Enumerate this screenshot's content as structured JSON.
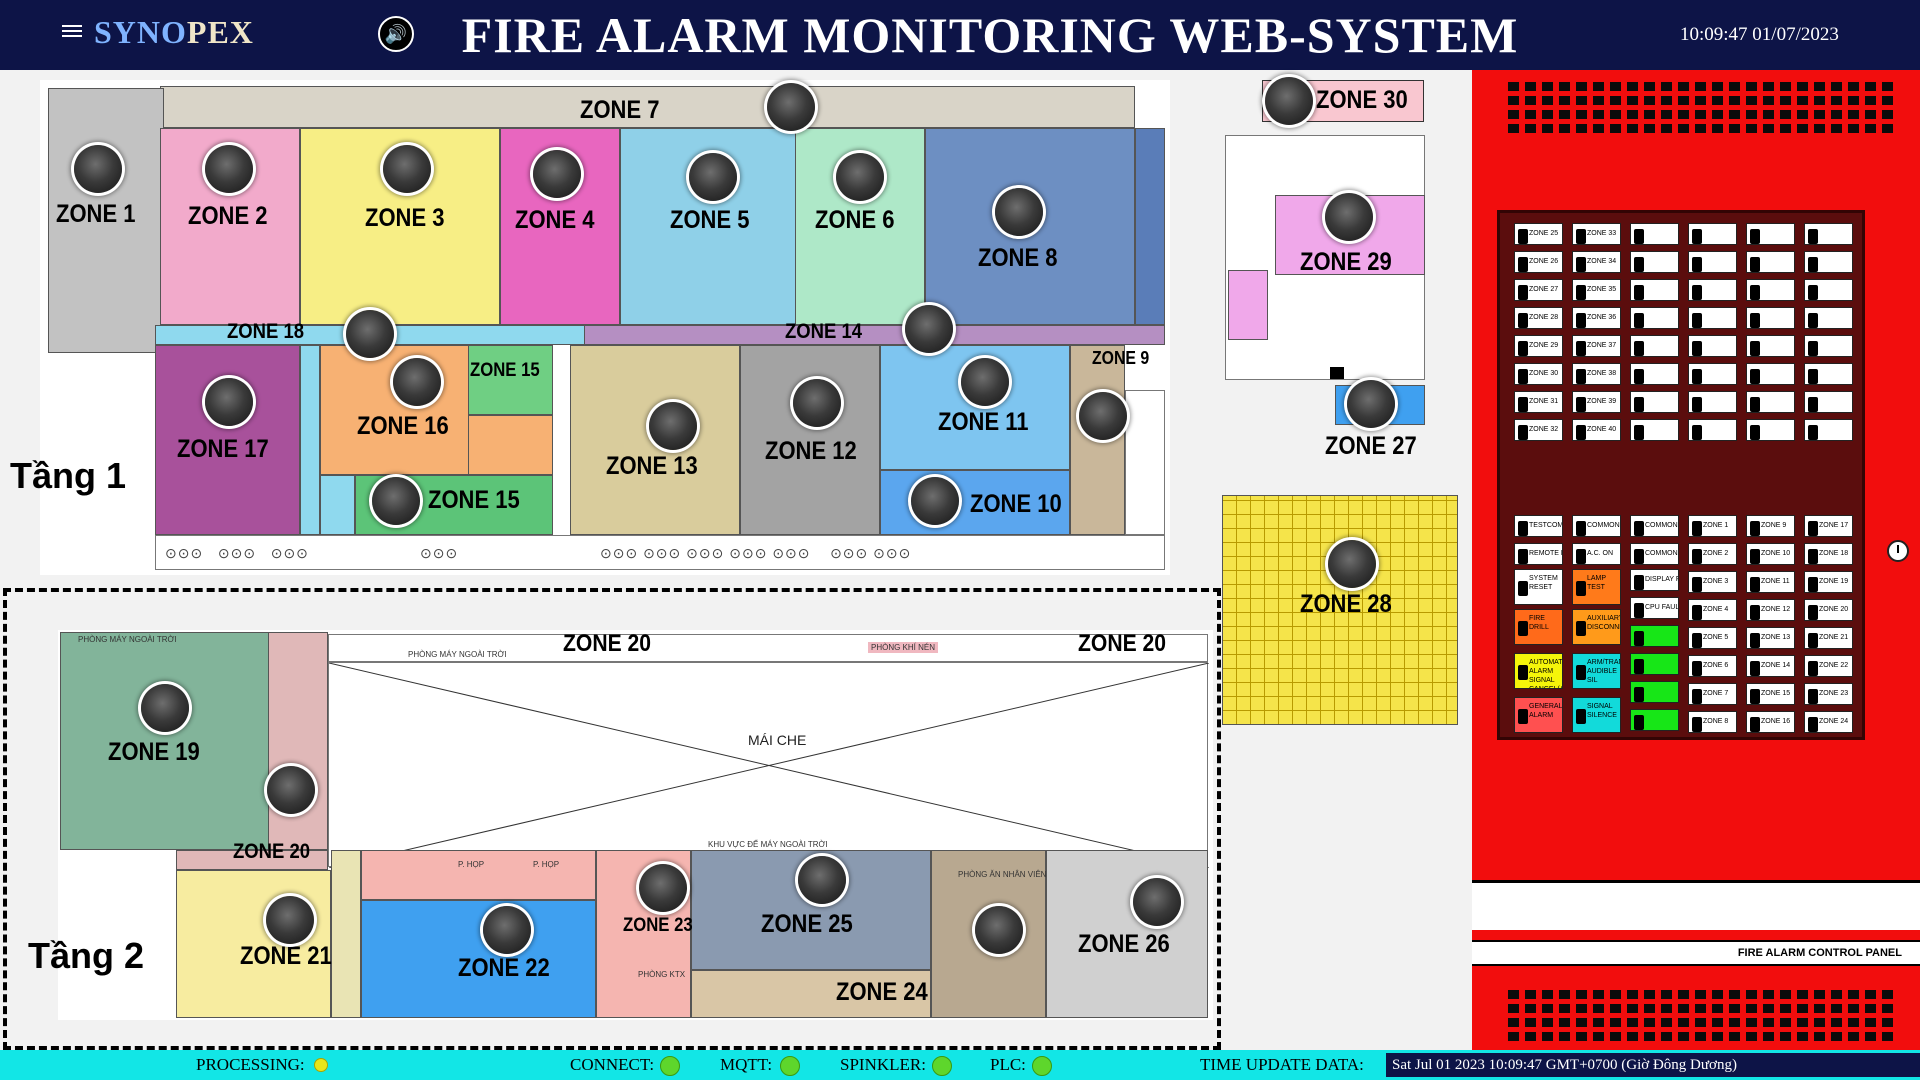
{
  "header": {
    "brand_part1": "SYNO",
    "brand_part2": "PEX",
    "title": "FIRE ALARM MONITORING WEB-SYSTEM",
    "clock": "10:09:47 01/07/2023"
  },
  "floors": {
    "floor1": "Tầng 1",
    "floor2": "Tầng 2",
    "roof": "MÁI CHE"
  },
  "zones": {
    "z1": "ZONE 1",
    "z2": "ZONE 2",
    "z3": "ZONE 3",
    "z4": "ZONE 4",
    "z5": "ZONE 5",
    "z6": "ZONE 6",
    "z7": "ZONE 7",
    "z8": "ZONE 8",
    "z9": "ZONE 9",
    "z10": "ZONE 10",
    "z11": "ZONE 11",
    "z12": "ZONE 12",
    "z13": "ZONE 13",
    "z14": "ZONE 14",
    "z15": "ZONE 15",
    "z15b": "ZONE 15",
    "z16": "ZONE 16",
    "z17": "ZONE 17",
    "z18": "ZONE 18",
    "z19": "ZONE 19",
    "z20a": "ZONE 20",
    "z20b": "ZONE 20",
    "z20c": "ZONE 20",
    "z21": "ZONE 21",
    "z22": "ZONE 22",
    "z23": "ZONE 23",
    "z24": "ZONE 24",
    "z25": "ZONE 25",
    "z26": "ZONE 26",
    "z27": "ZONE 27",
    "z28": "ZONE 28",
    "z29": "ZONE 29",
    "z30": "ZONE 30"
  },
  "room_labels": {
    "r1": "PHÒNG MÁY NGOÀI TRỜI",
    "r2": "PHÒNG MÁY NGOÀI TRỜI",
    "r3": "PHÒNG KHÍ NÉN",
    "r4": "KHU VỰC ĐỂ MÁY NGOÀI TRỜI",
    "r5": "P. HỌP",
    "r6": "P. HỌP",
    "r7": "PHÒNG KTX",
    "r8": "PHÒNG ĂN NHÂN VIÊN"
  },
  "panel": {
    "title": "FIRE ALARM CONTROL PANEL",
    "grid_labels": [
      "ZONE 25",
      "ZONE 33",
      "ZONE 26",
      "ZONE 34",
      "ZONE 27",
      "ZONE 35",
      "ZONE 28",
      "ZONE 36",
      "ZONE 29",
      "ZONE 37",
      "ZONE 30",
      "ZONE 38",
      "ZONE 31",
      "ZONE 39",
      "ZONE 32",
      "ZONE 40"
    ],
    "lower_zones": [
      "ZONE 1",
      "ZONE 2",
      "ZONE 3",
      "ZONE 4",
      "ZONE 5",
      "ZONE 6",
      "ZONE 7",
      "ZONE 8",
      "ZONE 9",
      "ZONE 10",
      "ZONE 11",
      "ZONE 12",
      "ZONE 13",
      "ZONE 14",
      "ZONE 15",
      "ZONE 16",
      "ZONE 17",
      "ZONE 18",
      "ZONE 19",
      "ZONE 20",
      "ZONE 21",
      "ZONE 22",
      "ZONE 23",
      "ZONE 24"
    ],
    "buttons": [
      {
        "label": "TESTCOMMO MODE",
        "color": "#ffffff"
      },
      {
        "label": "COMMON TROUBLE",
        "color": "#ffffff"
      },
      {
        "label": "COMMON ALARM",
        "color": "#ffffff"
      },
      {
        "label": "REMOTE FAILURE",
        "color": "#ffffff"
      },
      {
        "label": "A.C. ON",
        "color": "#ffffff"
      },
      {
        "label": "COMMON SUPERVISORY",
        "color": "#ffffff"
      },
      {
        "label": "SYSTEM RESET",
        "color": "#ffffff"
      },
      {
        "label": "LAMP TEST",
        "color": "#ff7a1a"
      },
      {
        "label": "DISPLAY FAULT (WATCHING TIME)",
        "color": "#ffffff"
      },
      {
        "label": "CPU FAULT GROUND FAULT",
        "color": "#ffffff"
      },
      {
        "label": "FIRE DRILL",
        "color": "#ff6a1a"
      },
      {
        "label": "AUXILIARY DISCONNECT",
        "color": "#ff9a1a"
      },
      {
        "label": "AUTOMATIC ALARM SIGNAL CANCEL(ACK)",
        "color": "#f5f50a"
      },
      {
        "label": "ARM/TRANSF AUDIBLE SIL",
        "color": "#12dada"
      },
      {
        "label": "GENERAL ALARM",
        "color": "#ff5050"
      },
      {
        "label": "SIGNAL SILENCE",
        "color": "#12dada"
      }
    ]
  },
  "footer": {
    "processing": "PROCESSING:",
    "connect": "CONNECT:",
    "mqtt": "MQTT:",
    "sprinkler": "SPINKLER:",
    "plc": "PLC:",
    "time_label": "TIME UPDATE DATA:",
    "time_value": "Sat Jul 01 2023 10:09:47 GMT+0700 (Giờ Đông Dương)"
  },
  "colors": {
    "header_bg": "#0d1447",
    "footer_bg": "#12e6e6",
    "panel_red": "#f20d0d",
    "status_green": "#5ed62c",
    "processing_yellow": "#e8e61a"
  }
}
